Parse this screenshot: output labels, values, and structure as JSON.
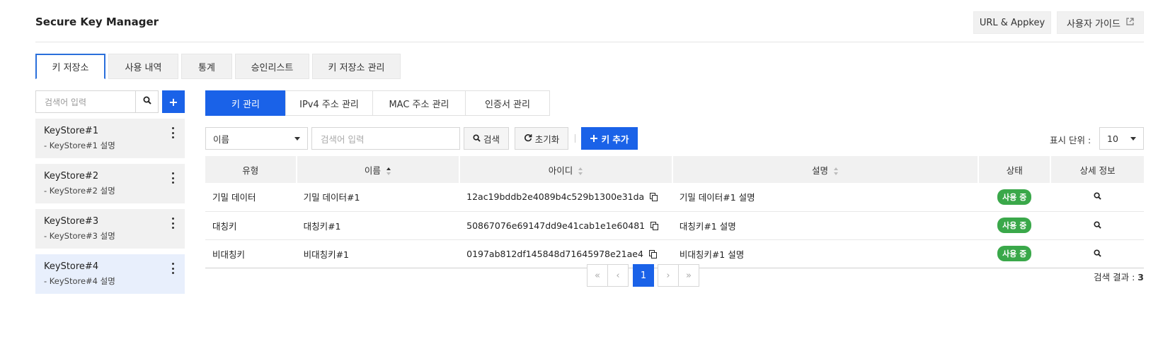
{
  "header": {
    "title": "Secure Key Manager",
    "url_appkey_label": "URL & Appkey",
    "user_guide_label": "사용자 가이드"
  },
  "top_tabs": [
    {
      "label": "키 저장소",
      "active": true
    },
    {
      "label": "사용 내역",
      "active": false
    },
    {
      "label": "통계",
      "active": false
    },
    {
      "label": "승인리스트",
      "active": false
    },
    {
      "label": "키 저장소 관리",
      "active": false
    }
  ],
  "sidebar": {
    "search_placeholder": "검색어 입력",
    "add_label": "+",
    "items": [
      {
        "name": "KeyStore#1",
        "desc": "- KeyStore#1 설명",
        "active": false
      },
      {
        "name": "KeyStore#2",
        "desc": "- KeyStore#2 설명",
        "active": false
      },
      {
        "name": "KeyStore#3",
        "desc": "- KeyStore#3 설명",
        "active": false
      },
      {
        "name": "KeyStore#4",
        "desc": "- KeyStore#4 설명",
        "active": true
      }
    ]
  },
  "sub_tabs": [
    {
      "label": "키 관리",
      "active": true
    },
    {
      "label": "IPv4 주소 관리",
      "active": false
    },
    {
      "label": "MAC 주소 관리",
      "active": false
    },
    {
      "label": "인증서 관리",
      "active": false
    }
  ],
  "toolbar": {
    "filter_selected": "이름",
    "search_placeholder": "검색어 입력",
    "search_label": "검색",
    "reset_label": "초기화",
    "add_key_label": "키 추가",
    "display_unit_label": "표시 단위 :",
    "display_unit_value": "10"
  },
  "table": {
    "columns": [
      {
        "label": "유형",
        "sort": "none"
      },
      {
        "label": "이름",
        "sort": "asc"
      },
      {
        "label": "아이디",
        "sort": "both"
      },
      {
        "label": "설명",
        "sort": "both"
      },
      {
        "label": "상태",
        "sort": "none"
      },
      {
        "label": "상세 정보",
        "sort": "none"
      }
    ],
    "rows": [
      {
        "type": "기밀 데이터",
        "name": "기밀 데이터#1",
        "id": "12ac19bddb2e4089b4c529b1300e31da",
        "desc": "기밀 데이터#1 설명",
        "status": "사용 중"
      },
      {
        "type": "대칭키",
        "name": "대칭키#1",
        "id": "50867076e69147dd9e41cab1e1e60481",
        "desc": "대칭키#1 설명",
        "status": "사용 중"
      },
      {
        "type": "비대칭키",
        "name": "비대칭키#1",
        "id": "0197ab812df145848d71645978e21ae4",
        "desc": "비대칭키#1 설명",
        "status": "사용 중"
      }
    ]
  },
  "pagination": {
    "current_page": "1",
    "first_label": "«",
    "prev_label": "‹",
    "next_label": "›",
    "last_label": "»"
  },
  "result": {
    "label": "검색 결과 :",
    "count": "3"
  },
  "colors": {
    "accent": "#1a62e8",
    "status_active": "#3aa84a",
    "selected_item_bg": "#e8effc"
  }
}
